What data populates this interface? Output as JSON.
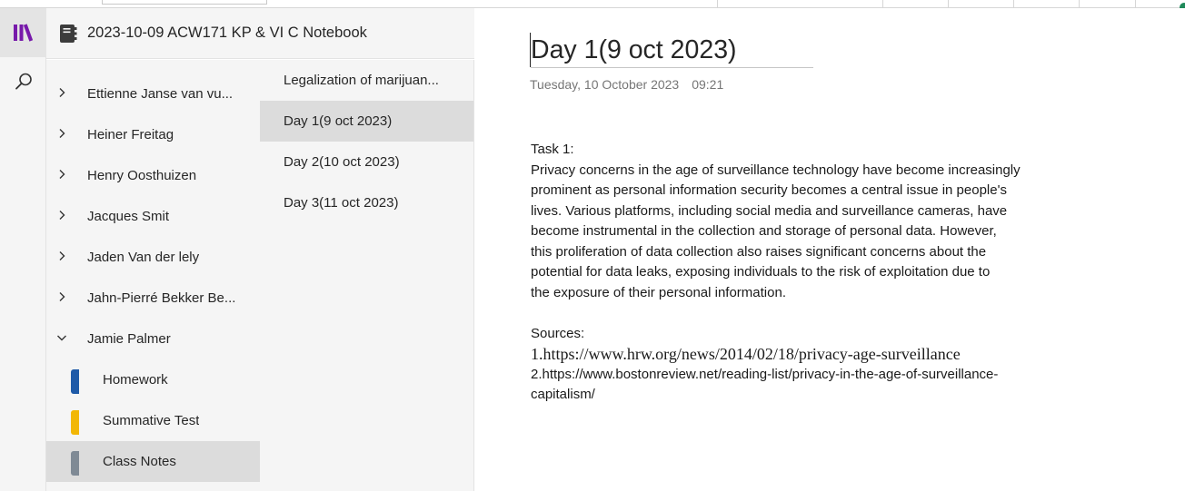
{
  "notebook": {
    "title": "2023-10-09 ACW171 KP & VI C Notebook"
  },
  "sections": [
    {
      "label": "Ettienne Janse van vu...",
      "expanded": false
    },
    {
      "label": "Heiner Freitag",
      "expanded": false
    },
    {
      "label": "Henry Oosthuizen",
      "expanded": false
    },
    {
      "label": "Jacques Smit",
      "expanded": false
    },
    {
      "label": "Jaden Van der lely",
      "expanded": false
    },
    {
      "label": "Jahn-Pierré Bekker Be...",
      "expanded": false
    },
    {
      "label": "Jamie Palmer",
      "expanded": true
    }
  ],
  "subsections": [
    {
      "label": "Homework",
      "color": "#1e5aa8"
    },
    {
      "label": "Summative Test",
      "color": "#f2b705"
    },
    {
      "label": "Class Notes",
      "color": "#7f8a95",
      "selected": true
    }
  ],
  "pages": [
    {
      "label": "Legalization of marijuan..."
    },
    {
      "label": "Day 1(9 oct 2023)",
      "selected": true
    },
    {
      "label": "Day 2(10 oct 2023)"
    },
    {
      "label": "Day 3(11 oct 2023)"
    }
  ],
  "page": {
    "title": "Day 1(9 oct 2023)",
    "date": "Tuesday, 10 October 2023",
    "time": "09:21",
    "task_heading": "Task 1:",
    "paragraph_lines": [
      "Privacy concerns in the age of surveillance technology have become increasingly",
      "prominent as personal information security becomes a central issue in people's",
      "lives. Various platforms, including social media and surveillance cameras, have",
      "become instrumental in the collection and storage of personal data. However,",
      "this proliferation of data collection also raises significant concerns about the",
      "potential for data leaks, exposing individuals to the risk of exploitation due to",
      "the exposure of their personal information."
    ],
    "sources_heading": "Sources:",
    "source_1": "1.https://www.hrw.org/news/2014/02/18/privacy-age-surveillance",
    "source_2_line1": "2.https://www.bostonreview.net/reading-list/privacy-in-the-age-of-surveillance-",
    "source_2_line2": "capitalism/"
  },
  "icons": {
    "notebooks": "notebooks-icon",
    "search": "search-icon",
    "notebook": "notebook-icon",
    "chevron_right": "chevron-right-icon",
    "chevron_down": "chevron-down-icon"
  },
  "colors": {
    "accent": "#7719aa",
    "pane_bg": "#f5f5f5",
    "selected_bg": "#dcdcdc"
  }
}
